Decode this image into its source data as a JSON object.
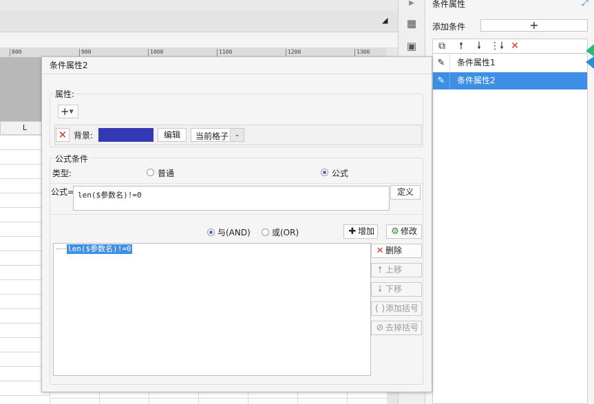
{
  "ruler": {
    "ticks": [
      "800",
      "900",
      "1000",
      "1100",
      "1200",
      "1300"
    ]
  },
  "sheet": {
    "column_letter": "L"
  },
  "right_panel": {
    "title": "条件属性",
    "add_condition_label": "添加条件",
    "add_symbol": "+",
    "items": [
      {
        "label": "条件属性1",
        "selected": false
      },
      {
        "label": "条件属性2",
        "selected": true
      }
    ]
  },
  "dialog": {
    "title": "条件属性2",
    "properties": {
      "label": "属性:",
      "add_symbol": "+",
      "background_label": "背景:",
      "background_color": "#3339b4",
      "edit_label": "编辑",
      "scope_value": "当前格子"
    },
    "formula_condition": {
      "label": "公式条件",
      "type_label": "类型:",
      "type_options": [
        "普通",
        "公式"
      ],
      "type_selected": "公式",
      "formula_label": "公式=",
      "formula_value": "len($参数名)!=0",
      "define_label": "定义",
      "and_label": "与(AND)",
      "or_label": "或(OR)",
      "logic_selected": "AND",
      "add_label": "增加",
      "modify_label": "修改",
      "conditions": [
        "len($参数名)!=0"
      ],
      "delete_label": "删除",
      "move_up_label": "上移",
      "move_down_label": "下移",
      "add_bracket_label": "添加括号",
      "remove_bracket_label": "去掉括号"
    }
  },
  "colors": {
    "accent": "#3d8fe6",
    "delete_red": "#d9322b"
  }
}
